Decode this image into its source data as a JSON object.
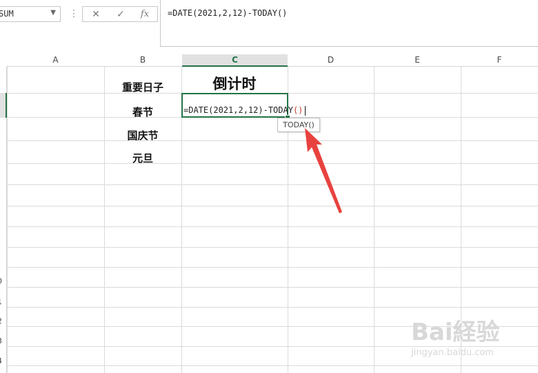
{
  "namebox": {
    "value": "SUM"
  },
  "formula_buttons": {
    "cancel": "✕",
    "enter": "✓",
    "fx": "fx"
  },
  "formula_bar": {
    "value": "=DATE(2021,2,12)-TODAY()"
  },
  "columns": [
    "A",
    "B",
    "C",
    "D",
    "E",
    "F"
  ],
  "row_numbers": [
    "0",
    "1",
    "2",
    "3",
    "4"
  ],
  "cells": {
    "b_important_days": "重要日子",
    "b_spring": "春节",
    "b_national": "国庆节",
    "b_newyear": "元旦",
    "c_countdown": "倒计时"
  },
  "editing": {
    "text": "=DATE(2021,2,12)-TODAY",
    "paren": "()"
  },
  "tooltip": {
    "text": "TODAY()"
  },
  "watermark": {
    "logo": "Bai経验",
    "url": "jingyan.baidu.com"
  },
  "colors": {
    "accent": "#217346",
    "arrow": "#e8423f"
  }
}
